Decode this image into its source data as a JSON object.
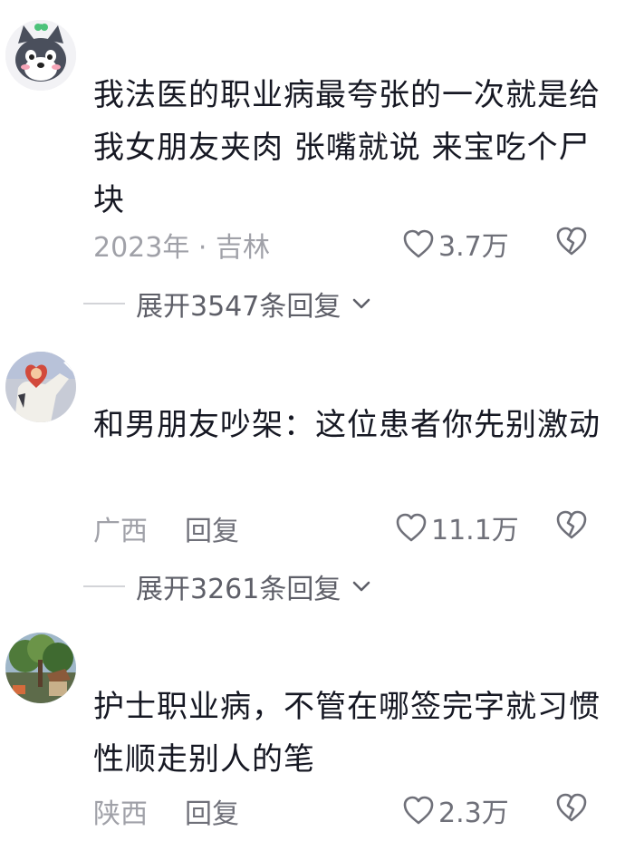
{
  "comments": [
    {
      "text": "我法医的职业病最夸张的一次就是给我女朋友夹肉 张嘴就说 来宝吃个尸块",
      "meta": "2023年 · 吉林",
      "reply_label": "",
      "likes": "3.7万",
      "expand_label": "展开3547条回复",
      "avatar": "cartoon-wolf-avatar"
    },
    {
      "text": "和男朋友吵架：这位患者你先别激动",
      "meta": "广西",
      "reply_label": "回复",
      "likes": "11.1万",
      "expand_label": "展开3261条回复",
      "avatar": "heart-character-avatar"
    },
    {
      "text": "护士职业病，不管在哪签完字就习惯性顺走别人的笔",
      "meta": "陕西",
      "reply_label": "回复",
      "likes": "2.3万",
      "expand_label": "",
      "avatar": "tree-scenery-avatar"
    }
  ],
  "colors": {
    "text": "#161823",
    "meta": "#a0a1a8",
    "secondary": "#6f7079",
    "divider": "#d3d4d8"
  },
  "icons": {
    "like": "heart-outline-icon",
    "dislike": "broken-heart-icon",
    "expand": "chevron-down-icon"
  }
}
